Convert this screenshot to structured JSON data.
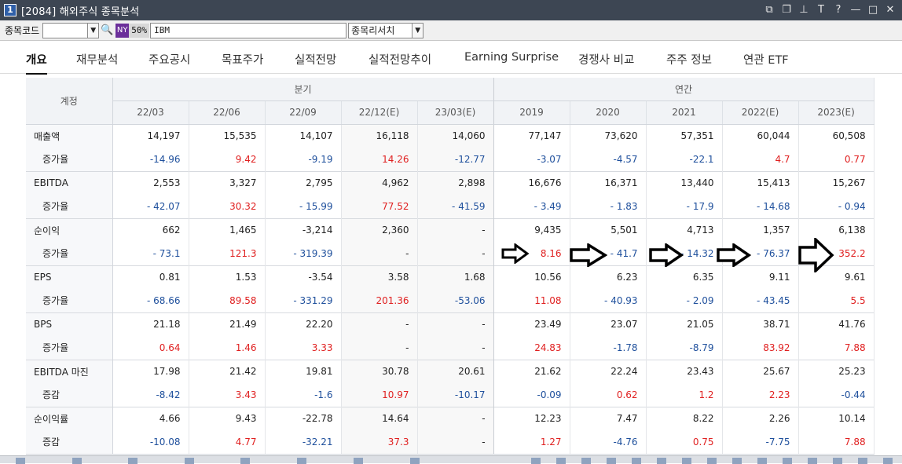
{
  "window": {
    "number": "1",
    "title": "[2084] 해외주식 종목분석",
    "controls": [
      "⧉",
      "❐",
      "⊥",
      "T",
      "?",
      "—",
      "□",
      "✕"
    ]
  },
  "toolbar": {
    "code_label": "종목코드",
    "code_value": "",
    "market_badge": "NY",
    "percent_badge": "50%",
    "stock_name": "IBM",
    "sort_label": "종목리서치"
  },
  "icons": {
    "dropdown": "▼",
    "search": "🔍"
  },
  "colors": {
    "positive": "#e02020",
    "negative": "#1e4f9c",
    "titlebar": "#3d4653",
    "header_bg": "#f1f3f6"
  },
  "tabs": [
    {
      "label": "개요",
      "active": true
    },
    {
      "label": "재무분석"
    },
    {
      "label": "주요공시"
    },
    {
      "label": "목표주가"
    },
    {
      "label": "실적전망"
    },
    {
      "label": "실적전망추이"
    },
    {
      "label": "Earning Surprise"
    },
    {
      "label": "경쟁사 비교"
    },
    {
      "label": "주주 정보"
    },
    {
      "label": "연관 ETF"
    }
  ],
  "table": {
    "account_header": "계정",
    "quarter_group": "분기",
    "annual_group": "연간",
    "columns": [
      "22/03",
      "22/06",
      "22/09",
      "22/12(E)",
      "23/03(E)",
      "2019",
      "2020",
      "2021",
      "2022(E)",
      "2023(E)"
    ],
    "rows": [
      {
        "label": "매출액",
        "values": [
          "14,197",
          "15,535",
          "14,107",
          "16,118",
          "14,060",
          "77,147",
          "73,620",
          "57,351",
          "60,044",
          "60,508"
        ]
      },
      {
        "label": "증가율",
        "values": [
          "-14.96",
          "9.42",
          "-9.19",
          "14.26",
          "-12.77",
          "-3.07",
          "-4.57",
          "-22.1",
          "4.7",
          "0.77"
        ]
      },
      {
        "label": "EBITDA",
        "values": [
          "2,553",
          "3,327",
          "2,795",
          "4,962",
          "2,898",
          "16,676",
          "16,371",
          "13,440",
          "15,413",
          "15,267"
        ]
      },
      {
        "label": "증가율",
        "values": [
          "- 42.07",
          "30.32",
          "- 15.99",
          "77.52",
          "- 41.59",
          "- 3.49",
          "- 1.83",
          "- 17.9",
          "- 14.68",
          "- 0.94"
        ]
      },
      {
        "label": "순이익",
        "values": [
          "662",
          "1,465",
          "-3,214",
          "2,360",
          "-",
          "9,435",
          "5,501",
          "4,713",
          "1,357",
          "6,138"
        ]
      },
      {
        "label": "증가율",
        "values": [
          "- 73.1",
          "121.3",
          "- 319.39",
          "-",
          "-",
          "8.16",
          "- 41.7",
          "- 14.32",
          "- 76.37",
          "352.2"
        ]
      },
      {
        "label": "EPS",
        "values": [
          "0.81",
          "1.53",
          "-3.54",
          "3.58",
          "1.68",
          "10.56",
          "6.23",
          "6.35",
          "9.11",
          "9.61"
        ]
      },
      {
        "label": "증가율",
        "values": [
          "- 68.66",
          "89.58",
          "- 331.29",
          "201.36",
          "-53.06",
          "11.08",
          "- 40.93",
          "- 2.09",
          "- 43.45",
          "5.5"
        ]
      },
      {
        "label": "BPS",
        "values": [
          "21.18",
          "21.49",
          "22.20",
          "-",
          "-",
          "23.49",
          "23.07",
          "21.05",
          "38.71",
          "41.76"
        ]
      },
      {
        "label": "증가율",
        "values": [
          "0.64",
          "1.46",
          "3.33",
          "-",
          "-",
          "24.83",
          "-1.78",
          "-8.79",
          "83.92",
          "7.88"
        ]
      },
      {
        "label": "EBITDA 마진",
        "values": [
          "17.98",
          "21.42",
          "19.81",
          "30.78",
          "20.61",
          "21.62",
          "22.24",
          "23.43",
          "25.67",
          "25.23"
        ]
      },
      {
        "label": "증감",
        "values": [
          "-8.42",
          "3.43",
          "-1.6",
          "10.97",
          "-10.17",
          "-0.09",
          "0.62",
          "1.2",
          "2.23",
          "-0.44"
        ]
      },
      {
        "label": "순이익률",
        "values": [
          "4.66",
          "9.43",
          "-22.78",
          "14.64",
          "-",
          "12.23",
          "7.47",
          "8.22",
          "2.26",
          "10.14"
        ]
      },
      {
        "label": "증감",
        "values": [
          "-10.08",
          "4.77",
          "-32.21",
          "37.3",
          "-",
          "1.27",
          "-4.76",
          "0.75",
          "-7.75",
          "7.88"
        ]
      }
    ]
  }
}
